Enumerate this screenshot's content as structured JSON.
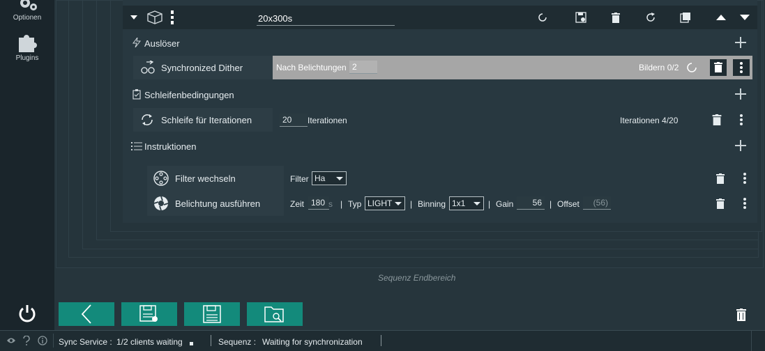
{
  "sidebar": {
    "items": [
      {
        "label": "Optionen",
        "icon": "gear-icon"
      },
      {
        "label": "Plugins",
        "icon": "puzzle-icon"
      }
    ]
  },
  "card": {
    "name": "20x300s",
    "triggers": {
      "title": "Auslöser",
      "item": {
        "label": "Synchronized Dither",
        "param_label": "Nach Belichtungen",
        "param_value": "2",
        "status": "Bildern 0/2"
      }
    },
    "conditions": {
      "title": "Schleifenbedingungen",
      "item": {
        "label": "Schleife für Iterationen",
        "value": "20",
        "unit": "Iterationen",
        "status": "Iterationen 4/20"
      }
    },
    "instructions": {
      "title": "Instruktionen",
      "filter": {
        "label": "Filter wechseln",
        "field_label": "Filter",
        "value": "Ha"
      },
      "exposure": {
        "label": "Belichtung ausführen",
        "time_label": "Zeit",
        "time_value": "180",
        "time_unit": "s",
        "sep": "|",
        "type_label": "Typ",
        "type_value": "LIGHT",
        "binning_label": "Binning",
        "binning_value": "1x1",
        "gain_label": "Gain",
        "gain_value": "56",
        "offset_label": "Offset",
        "offset_value": "(56)"
      }
    }
  },
  "end_area": "Sequenz Endbereich",
  "status_bar": {
    "sync_label": "Sync Service :",
    "sync_value": "1/2 clients waiting",
    "seq_label": "Sequenz :",
    "seq_value": "Waiting for synchronization"
  },
  "colors": {
    "accent": "#138a7b",
    "background": "#26353c",
    "highlight_row": "#a6a6a6"
  }
}
